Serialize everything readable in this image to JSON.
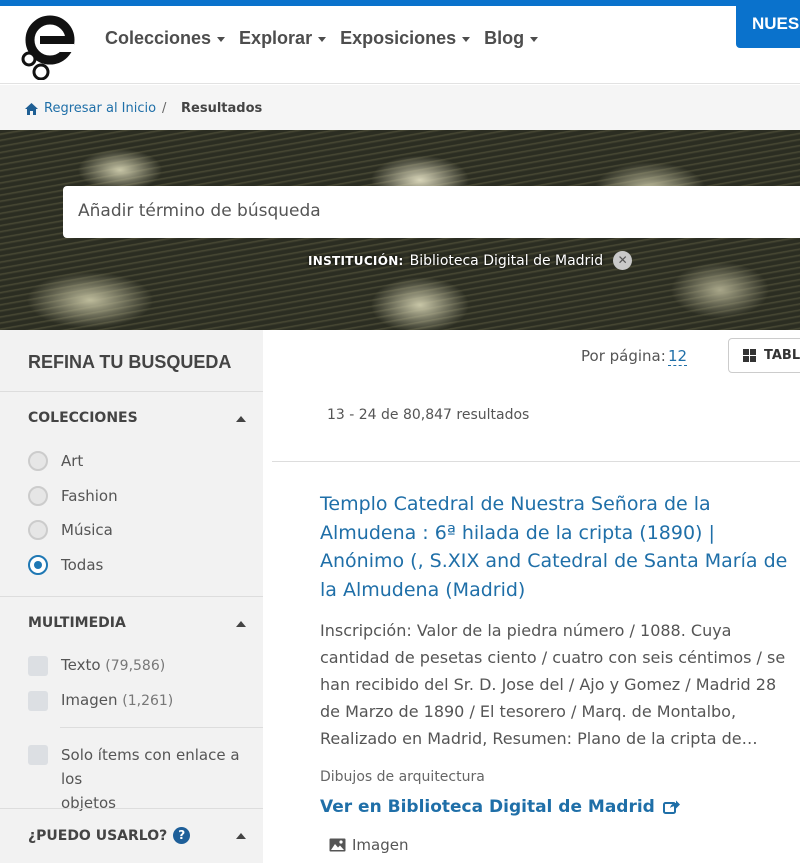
{
  "header": {
    "nav": [
      {
        "label": "Colecciones"
      },
      {
        "label": "Explorar"
      },
      {
        "label": "Exposiciones"
      },
      {
        "label": "Blog"
      }
    ],
    "cta_label": "NUES"
  },
  "breadcrumb": {
    "home": "Regresar al Inicio",
    "separator": "/",
    "current": "Resultados"
  },
  "search": {
    "placeholder": "Añadir término de búsqueda",
    "filter_key": "INSTITUCIÓN:",
    "filter_value": "Biblioteca Digital de Madrid"
  },
  "sidebar": {
    "title": "REFINA TU BUSQUEDA",
    "collections": {
      "heading": "COLECCIONES",
      "options": [
        {
          "label": "Art",
          "selected": false
        },
        {
          "label": "Fashion",
          "selected": false
        },
        {
          "label": "Música",
          "selected": false
        },
        {
          "label": "Todas",
          "selected": true
        }
      ]
    },
    "multimedia": {
      "heading": "MULTIMEDIA",
      "options": [
        {
          "label": "Texto",
          "count": "(79,586)"
        },
        {
          "label": "Imagen",
          "count": "(1,261)"
        }
      ],
      "links_only_line1": "Solo ítems con enlace a los",
      "links_only_line2": "objetos"
    },
    "usage": {
      "heading": "¿PUEDO USARLO?"
    }
  },
  "results": {
    "per_page_label": "Por página:",
    "per_page_value": "12",
    "view_toggle": "TABLA",
    "count_text": "13 - 24 de 80,847 resultados",
    "item": {
      "title": "Templo Catedral de Nuestra Señora de la Almudena : 6ª hilada de la cripta (1890) | Anónimo (, S.XIX and Catedral de Santa María de la Almudena (Madrid)",
      "description": "Inscripción: Valor de la piedra número / 1088. Cuya cantidad de pesetas ciento / cuatro con seis céntimos / se han recibido del Sr. D. Jose del / Ajo y Gomez / Madrid 28 de Marzo de 1890 / El tesorero / Marq. de Montalbo, Realizado en Madrid, Resumen: Plano de la cripta de…",
      "type": "Dibujos de arquitectura",
      "link_label": "Ver en Biblioteca Digital de Madrid",
      "media_label": "Imagen"
    }
  },
  "colors": {
    "brand_blue": "#0a72cc",
    "link_blue": "#1f6fa8"
  }
}
